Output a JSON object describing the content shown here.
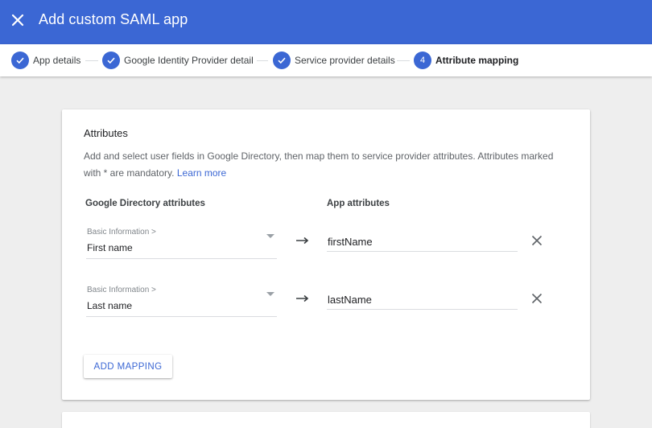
{
  "header": {
    "title": "Add custom SAML app",
    "close_icon": "close-icon",
    "bg_color": "#3b67d4"
  },
  "stepper": {
    "steps": [
      {
        "label": "App details",
        "state": "done",
        "icon": "check-icon"
      },
      {
        "label": "Google Identity Provider details",
        "state": "done",
        "icon": "check-icon"
      },
      {
        "label": "Service provider details",
        "state": "done",
        "icon": "check-icon"
      },
      {
        "label": "Attribute mapping",
        "state": "active",
        "number": "4"
      }
    ]
  },
  "attributes": {
    "title": "Attributes",
    "description": "Add and select user fields in Google Directory, then map them to service provider attributes. Attributes marked with * are mandatory.",
    "learn_more": "Learn more",
    "col_directory": "Google Directory attributes",
    "col_app": "App attributes",
    "mappings": [
      {
        "category": "Basic Information >",
        "directory_value": "First name",
        "app_value": "firstName"
      },
      {
        "category": "Basic Information >",
        "directory_value": "Last name",
        "app_value": "lastName"
      }
    ],
    "add_mapping": "ADD MAPPING"
  }
}
